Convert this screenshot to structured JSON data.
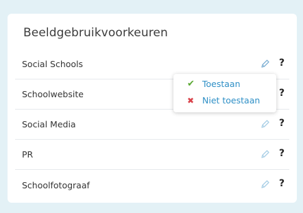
{
  "panel": {
    "title": "Beeldgebruikvoorkeuren"
  },
  "rows": [
    {
      "label": "Social Schools",
      "edit_icon": "pencil-icon",
      "help_label": "?"
    },
    {
      "label": "Schoolwebsite",
      "edit_icon": "pencil-icon",
      "help_label": "?"
    },
    {
      "label": "Social Media",
      "edit_icon": "pencil-icon",
      "help_label": "?"
    },
    {
      "label": "PR",
      "edit_icon": "pencil-icon",
      "help_label": "?"
    },
    {
      "label": "Schoolfotograaf",
      "edit_icon": "pencil-icon",
      "help_label": "?"
    }
  ],
  "dropdown": {
    "items": [
      {
        "label": "Toestaan",
        "icon": "check-icon",
        "icon_glyph": "✔",
        "icon_color": "#5aa832"
      },
      {
        "label": "Niet toestaan",
        "icon": "cross-icon",
        "icon_glyph": "✖",
        "icon_color": "#d9424a"
      }
    ]
  },
  "colors": {
    "background": "#e3f1f6",
    "link": "#2e8fc6",
    "pencil_active": "#7fb0d3",
    "pencil_inactive": "#a9cfe6"
  }
}
